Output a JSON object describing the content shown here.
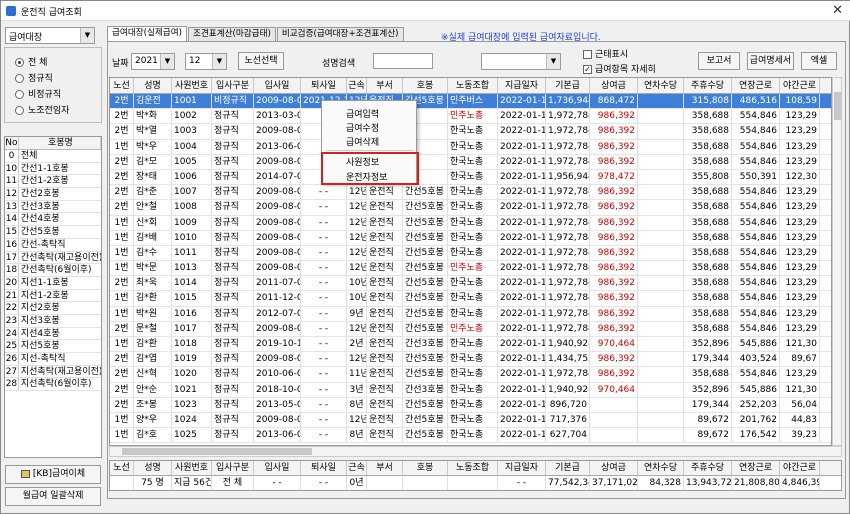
{
  "window": {
    "title": "운전직 급여조회",
    "close": "✕"
  },
  "left": {
    "category_select": "급여대장",
    "radios": [
      {
        "label": "전 체",
        "checked": true
      },
      {
        "label": "정규직",
        "checked": false
      },
      {
        "label": "비정규직",
        "checked": false
      },
      {
        "label": "노조전임자",
        "checked": false
      }
    ],
    "list_headers": {
      "no": "No",
      "name": "호봉명"
    },
    "list_rows": [
      {
        "no": "0",
        "name": "전체"
      },
      {
        "no": "10",
        "name": "간선1-1호봉"
      },
      {
        "no": "11",
        "name": "간선1-2호봉"
      },
      {
        "no": "12",
        "name": "간선2호봉"
      },
      {
        "no": "13",
        "name": "간선3호봉"
      },
      {
        "no": "14",
        "name": "간선4호봉"
      },
      {
        "no": "15",
        "name": "간선5호봉"
      },
      {
        "no": "16",
        "name": "간선-촉탁직"
      },
      {
        "no": "17",
        "name": "간선촉탁(재고용이전)"
      },
      {
        "no": "18",
        "name": "간선촉탁(6월이후)"
      },
      {
        "no": "20",
        "name": "지선1-1호봉"
      },
      {
        "no": "21",
        "name": "지선1-2호봉"
      },
      {
        "no": "22",
        "name": "지선2호봉"
      },
      {
        "no": "23",
        "name": "지선3호봉"
      },
      {
        "no": "24",
        "name": "지선4호봉"
      },
      {
        "no": "25",
        "name": "지선5호봉"
      },
      {
        "no": "26",
        "name": "지선-촉탁직"
      },
      {
        "no": "27",
        "name": "지선촉탁(재고용이전)"
      },
      {
        "no": "28",
        "name": "지선촉탁(6월이후)"
      }
    ],
    "btn_transfer": "[KB]급여이체",
    "btn_delete_all": "월급여 일괄삭제"
  },
  "tabs": [
    {
      "label": "급여대장(실제급여)",
      "active": true
    },
    {
      "label": "조견표계산(마감급태)",
      "active": false
    },
    {
      "label": "비교검증(급여대장+조견표계산)",
      "active": false
    }
  ],
  "notice": "※실제 급여대장에 입력된 급여자료입니다.",
  "filter": {
    "date_label": "날짜",
    "year": "2021",
    "month": "12",
    "route_btn": "노선선택",
    "name_search_label": "성명검색",
    "name_search_value": "",
    "combo_value": "",
    "chk_attendance": {
      "label": "근태표시",
      "checked": false
    },
    "chk_detail": {
      "label": "급여항목 자세히",
      "checked": true
    },
    "btn_report": "보고서",
    "btn_payslip": "급여명세서",
    "btn_excel": "엑셀"
  },
  "grid": {
    "headers": [
      "노선",
      "성명",
      "사원번호",
      "입사구분",
      "입사일",
      "퇴사일",
      "근속",
      "부서",
      "호봉",
      "노동조합",
      "지급일자",
      "기본급",
      "상여금",
      "연차수당",
      "주휴수당",
      "연장근로",
      "야간근로"
    ],
    "rows": [
      [
        "2번",
        "김운전",
        "1001",
        "비정규직",
        "2009-08-01",
        "2021-12-28",
        "12년",
        "운전직",
        "간선5호봉",
        "민주버스",
        "2022-01-15",
        "1,736,944",
        "868,472",
        "",
        "315,808",
        "486,516",
        "108,59"
      ],
      [
        "2번",
        "박*화",
        "1002",
        "정규직",
        "2013-03-01",
        "",
        "",
        "",
        "",
        "민주노총",
        "2022-01-15",
        "1,972,784",
        "986,392",
        "",
        "358,688",
        "554,846",
        "123,29"
      ],
      [
        "2번",
        "박*열",
        "1003",
        "정규직",
        "2009-08-01",
        "",
        "",
        "",
        "",
        "한국노총",
        "2022-01-15",
        "1,972,784",
        "986,392",
        "",
        "358,688",
        "554,846",
        "123,29"
      ],
      [
        "1번",
        "박*우",
        "1004",
        "정규직",
        "2013-06-01",
        "",
        "",
        "",
        "",
        "한국노총",
        "2022-01-15",
        "1,972,784",
        "986,392",
        "",
        "358,688",
        "554,846",
        "123,29"
      ],
      [
        "2번",
        "김*모",
        "1005",
        "정규직",
        "2009-08-01",
        "",
        "",
        "",
        "",
        "한국노총",
        "2022-01-15",
        "1,972,784",
        "986,392",
        "",
        "358,688",
        "554,846",
        "123,29"
      ],
      [
        "2번",
        "장*태",
        "1006",
        "정규직",
        "2014-07-01",
        "",
        "",
        "",
        "",
        "한국노총",
        "2022-01-15",
        "1,956,944",
        "978,472",
        "",
        "355,808",
        "550,391",
        "122,30"
      ],
      [
        "2번",
        "김*준",
        "1007",
        "정규직",
        "2009-08-01",
        "- -",
        "12년",
        "운전직",
        "간선5호봉",
        "한국노총",
        "2022-01-15",
        "1,972,784",
        "986,392",
        "",
        "358,688",
        "554,846",
        "123,29"
      ],
      [
        "2번",
        "안*철",
        "1008",
        "정규직",
        "2009-08-01",
        "- -",
        "12년",
        "운전직",
        "간선5호봉",
        "한국노총",
        "2022-01-15",
        "1,972,784",
        "986,392",
        "",
        "358,688",
        "554,846",
        "123,29"
      ],
      [
        "1번",
        "신*회",
        "1009",
        "정규직",
        "2009-08-01",
        "- -",
        "12년",
        "운전직",
        "간선5호봉",
        "한국노총",
        "2022-01-15",
        "1,972,784",
        "986,392",
        "",
        "358,688",
        "554,846",
        "123,29"
      ],
      [
        "1번",
        "김*배",
        "1010",
        "정규직",
        "2009-08-01",
        "- -",
        "12년",
        "운전직",
        "간선5호봉",
        "한국노총",
        "2022-01-15",
        "1,972,784",
        "986,392",
        "",
        "358,688",
        "554,846",
        "123,29"
      ],
      [
        "1번",
        "김*수",
        "1011",
        "정규직",
        "2009-08-01",
        "- -",
        "12년",
        "운전직",
        "간선5호봉",
        "한국노총",
        "2022-01-15",
        "1,972,784",
        "986,392",
        "",
        "358,688",
        "554,846",
        "123,29"
      ],
      [
        "1번",
        "박*문",
        "1013",
        "정규직",
        "2009-08-01",
        "- -",
        "12년",
        "운전직",
        "간선5호봉",
        "민주노총",
        "2022-01-15",
        "1,972,784",
        "986,392",
        "",
        "358,688",
        "554,846",
        "123,29"
      ],
      [
        "2번",
        "최*욱",
        "1014",
        "정규직",
        "2011-07-01",
        "- -",
        "10년",
        "운전직",
        "간선5호봉",
        "한국노총",
        "2022-01-15",
        "1,972,784",
        "986,392",
        "",
        "358,688",
        "554,846",
        "123,29"
      ],
      [
        "1번",
        "김*환",
        "1015",
        "정규직",
        "2011-12-01",
        "- -",
        "10년",
        "운전직",
        "간선5호봉",
        "한국노총",
        "2022-01-15",
        "1,972,784",
        "986,392",
        "",
        "358,688",
        "554,846",
        "123,29"
      ],
      [
        "1번",
        "박*원",
        "1016",
        "정규직",
        "2012-07-01",
        "- -",
        "9년",
        "운전직",
        "간선5호봉",
        "한국노총",
        "2022-01-15",
        "1,972,784",
        "986,392",
        "",
        "358,688",
        "554,846",
        "123,29"
      ],
      [
        "2번",
        "문*철",
        "1017",
        "정규직",
        "2009-08-01",
        "- -",
        "12년",
        "운전직",
        "간선5호봉",
        "민주노총",
        "2022-01-15",
        "1,972,784",
        "986,392",
        "",
        "358,688",
        "554,846",
        "123,29"
      ],
      [
        "1번",
        "김*환",
        "1018",
        "정규직",
        "2019-10-15",
        "- -",
        "2년",
        "운전직",
        "간선3호봉",
        "한국노총",
        "2022-01-15",
        "1,940,928",
        "970,464",
        "",
        "352,896",
        "545,886",
        "121,30"
      ],
      [
        "2번",
        "김*엽",
        "1019",
        "정규직",
        "2009-08-01",
        "- -",
        "12년",
        "운전직",
        "간선5호봉",
        "한국노총",
        "2022-01-15",
        "1,434,752",
        "986,392",
        "",
        "179,344",
        "403,524",
        "89,67"
      ],
      [
        "2번",
        "신*혁",
        "1020",
        "정규직",
        "2010-06-09",
        "- -",
        "11년",
        "운전직",
        "간선5호봉",
        "한국노총",
        "2022-01-15",
        "1,972,784",
        "986,392",
        "",
        "358,688",
        "554,846",
        "123,29"
      ],
      [
        "2번",
        "안*순",
        "1021",
        "정규직",
        "2018-10-01",
        "- -",
        "3년",
        "운전직",
        "간선3호봉",
        "한국노총",
        "2022-01-15",
        "1,940,928",
        "970,464",
        "",
        "352,896",
        "545,886",
        "121,30"
      ],
      [
        "2번",
        "조*봉",
        "1023",
        "정규직",
        "2013-05-01",
        "- -",
        "8년",
        "운전직",
        "간선5호봉",
        "한국노총",
        "2022-01-15",
        "896,720",
        "",
        "",
        "179,344",
        "252,203",
        "56,04"
      ],
      [
        "1번",
        "양*우",
        "1024",
        "정규직",
        "2009-08-01",
        "- -",
        "12년",
        "운전직",
        "간선5호봉",
        "한국노총",
        "2022-01-15",
        "717,376",
        "",
        "",
        "89,672",
        "201,762",
        "44,83"
      ],
      [
        "1번",
        "김*호",
        "1025",
        "정규직",
        "2013-06-01",
        "- -",
        "8년",
        "운전직",
        "간선5호봉",
        "한국노총",
        "2022-01-15",
        "627,704",
        "",
        "",
        "89,672",
        "176,542",
        "39,23"
      ]
    ]
  },
  "summary": {
    "headers": [
      "노선",
      "성명",
      "사원번호",
      "입사구분",
      "입사일",
      "퇴사일",
      "근속",
      "부서",
      "호봉",
      "노동조합",
      "지급일자",
      "기본급",
      "상여금",
      "연차수당",
      "주휴수당",
      "연장근로",
      "야간근로"
    ],
    "values": [
      "",
      "75 명",
      "지급 56건",
      "전 체",
      "- -",
      "- -",
      "0년",
      "",
      "",
      "",
      "- -",
      "77,542,344",
      "37,171,024",
      "84,328",
      "13,943,720",
      "21,808,801",
      "4,846,397"
    ]
  },
  "context_menu": {
    "items": [
      "급여입력",
      "급여수정",
      "급여삭제",
      "사원정보",
      "운전자정보"
    ]
  }
}
